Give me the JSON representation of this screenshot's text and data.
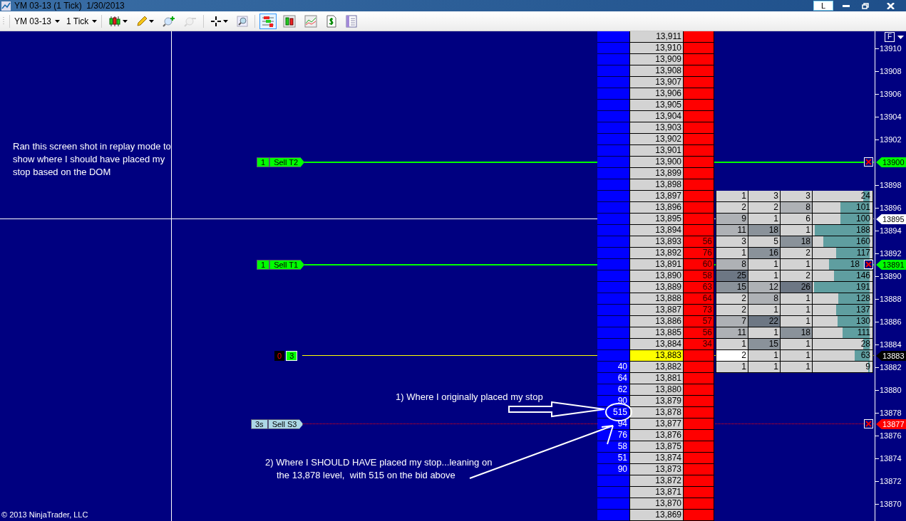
{
  "window": {
    "title": "YM 03-13 (1 Tick)  1/30/2013",
    "buttons": [
      "L"
    ]
  },
  "toolbar": {
    "instrument": "YM 03-13",
    "interval": "1 Tick",
    "tools": [
      {
        "kind": "candles",
        "selected": false,
        "disabled": false
      },
      {
        "kind": "pencil",
        "selected": false,
        "disabled": false
      },
      {
        "kind": "zoom-in",
        "selected": false,
        "disabled": false
      },
      {
        "kind": "zoom-out",
        "selected": false,
        "disabled": true
      },
      {
        "kind": "crosshair",
        "selected": false,
        "disabled": false
      },
      {
        "kind": "magnifier",
        "selected": false,
        "disabled": false
      },
      {
        "kind": "dom",
        "selected": true,
        "disabled": false
      },
      {
        "kind": "bars",
        "selected": false,
        "disabled": false
      },
      {
        "kind": "chart",
        "selected": false,
        "disabled": false
      },
      {
        "kind": "dollar",
        "selected": false,
        "disabled": false
      },
      {
        "kind": "form",
        "selected": false,
        "disabled": false
      }
    ]
  },
  "ladder": {
    "rows": [
      {
        "price": "13,911",
        "current": false
      },
      {
        "price": "13,910",
        "current": false,
        "axis": "13910"
      },
      {
        "price": "13,909",
        "current": false
      },
      {
        "price": "13,908",
        "current": false,
        "axis": "13908"
      },
      {
        "price": "13,907",
        "current": false
      },
      {
        "price": "13,906",
        "current": false,
        "axis": "13906"
      },
      {
        "price": "13,905",
        "current": false
      },
      {
        "price": "13,904",
        "current": false,
        "axis": "13904"
      },
      {
        "price": "13,903",
        "current": false
      },
      {
        "price": "13,902",
        "current": false,
        "axis": "13902"
      },
      {
        "price": "13,901",
        "current": false
      },
      {
        "price": "13,900",
        "current": false,
        "flag": {
          "text": "13900",
          "color": "#00ff00"
        },
        "line": {
          "kind": "target",
          "tag": [
            "1",
            "Sell T2"
          ]
        }
      },
      {
        "price": "13,899",
        "current": false
      },
      {
        "price": "13,898",
        "current": false,
        "axis": "13898"
      },
      {
        "price": "13,897",
        "current": false,
        "volume": {
          "cells": [
            "1",
            "3",
            "3"
          ],
          "total": "24",
          "level": 0.12
        }
      },
      {
        "price": "13,896",
        "current": false,
        "axis": "13896",
        "volume": {
          "cells": [
            "2",
            "2",
            "8"
          ],
          "total": "101",
          "level": 0.52
        }
      },
      {
        "price": "13,895",
        "current": false,
        "flag": {
          "text": "13895",
          "color": "#ffffff"
        },
        "line": {
          "kind": "crosshair"
        },
        "volume": {
          "cells": [
            "9",
            "1",
            "6"
          ],
          "total": "100",
          "level": 0.52
        }
      },
      {
        "price": "13,894",
        "current": false,
        "axis": "13894",
        "volume": {
          "cells": [
            "11",
            "18",
            "1"
          ],
          "total": "188",
          "level": 0.99
        }
      },
      {
        "price": "13,893",
        "ask": "56",
        "current": false,
        "volume": {
          "cells": [
            "3",
            "5",
            "18"
          ],
          "total": "160",
          "level": 0.83
        }
      },
      {
        "price": "13,892",
        "ask": "76",
        "current": false,
        "axis": "13892",
        "volume": {
          "cells": [
            "1",
            "16",
            "2"
          ],
          "total": "117",
          "level": 0.6
        }
      },
      {
        "price": "13,891",
        "ask": "60",
        "current": false,
        "flag": {
          "text": "13891",
          "color": "#00ff00"
        },
        "line": {
          "kind": "target",
          "tag": [
            "1",
            "Sell T1"
          ]
        },
        "volume": {
          "cells": [
            "8",
            "1",
            "1"
          ],
          "total": "18",
          "level": 0.73
        }
      },
      {
        "price": "13,890",
        "ask": "58",
        "current": false,
        "axis": "13890",
        "volume": {
          "cells": [
            "25",
            "1",
            "2"
          ],
          "total": "146",
          "level": 0.64
        }
      },
      {
        "price": "13,889",
        "ask": "63",
        "current": false,
        "volume": {
          "cells": [
            "15",
            "12",
            "26"
          ],
          "total": "191",
          "level": 1
        }
      },
      {
        "price": "13,888",
        "ask": "64",
        "current": false,
        "axis": "13888",
        "volume": {
          "cells": [
            "2",
            "8",
            "1"
          ],
          "total": "128",
          "level": 0.57
        }
      },
      {
        "price": "13,887",
        "ask": "73",
        "current": false,
        "volume": {
          "cells": [
            "2",
            "1",
            "1"
          ],
          "total": "137",
          "level": 0.6
        }
      },
      {
        "price": "13,886",
        "ask": "57",
        "current": false,
        "axis": "13886",
        "volume": {
          "cells": [
            "7",
            "22",
            "1"
          ],
          "total": "130",
          "level": 0.58
        }
      },
      {
        "price": "13,885",
        "ask": "56",
        "current": false,
        "volume": {
          "cells": [
            "11",
            "1",
            "18"
          ],
          "total": "111",
          "level": 0.49
        }
      },
      {
        "price": "13,884",
        "ask": "34",
        "current": false,
        "axis": "13884",
        "volume": {
          "cells": [
            "1",
            "15",
            "1"
          ],
          "total": "28",
          "level": 0.12
        }
      },
      {
        "price": "13,883",
        "current": true,
        "flag": {
          "text": "13883",
          "color": "#000000"
        },
        "line": {
          "kind": "position",
          "tag": [
            "0",
            "3"
          ]
        },
        "volume": {
          "cells": [
            "2",
            "1",
            "1"
          ],
          "total": "63",
          "level": 0.27
        }
      },
      {
        "price": "13,882",
        "bid": "40",
        "current": false,
        "axis": "13882",
        "volume": {
          "cells": [
            "1",
            "1",
            "1"
          ],
          "total": "9",
          "level": 0.03
        }
      },
      {
        "price": "13,881",
        "bid": "64",
        "current": false
      },
      {
        "price": "13,880",
        "bid": "62",
        "current": false,
        "axis": "13880"
      },
      {
        "price": "13,879",
        "bid": "90",
        "current": false
      },
      {
        "price": "13,878",
        "bid": "515",
        "current": false,
        "axis": "13878"
      },
      {
        "price": "13,877",
        "bid": "94",
        "current": false,
        "flag": {
          "text": "13877",
          "color": "#ff0000"
        },
        "line": {
          "kind": "stop",
          "tag": [
            "3s",
            "Sell S3"
          ]
        }
      },
      {
        "price": "13,876",
        "bid": "76",
        "current": false,
        "axis": "13876"
      },
      {
        "price": "13,875",
        "bid": "58",
        "current": false
      },
      {
        "price": "13,874",
        "bid": "51",
        "current": false,
        "axis": "13874"
      },
      {
        "price": "13,873",
        "bid": "90",
        "current": false
      },
      {
        "price": "13,872",
        "current": false,
        "axis": "13872"
      },
      {
        "price": "13,871",
        "current": false
      },
      {
        "price": "13,870",
        "current": false,
        "axis": "13870"
      },
      {
        "price": "13,869",
        "current": false
      }
    ]
  },
  "axis_button": "F",
  "notes": [
    "Ran this screen shot in replay mode to show where I should have placed my stop based on the DOM",
    "1) Where I originally placed my stop",
    "2) Where I SHOULD HAVE placed my stop...leaning on the 13,878 level,  with 515 on the bid above"
  ],
  "copyright": "© 2013 NinjaTrader, LLC"
}
